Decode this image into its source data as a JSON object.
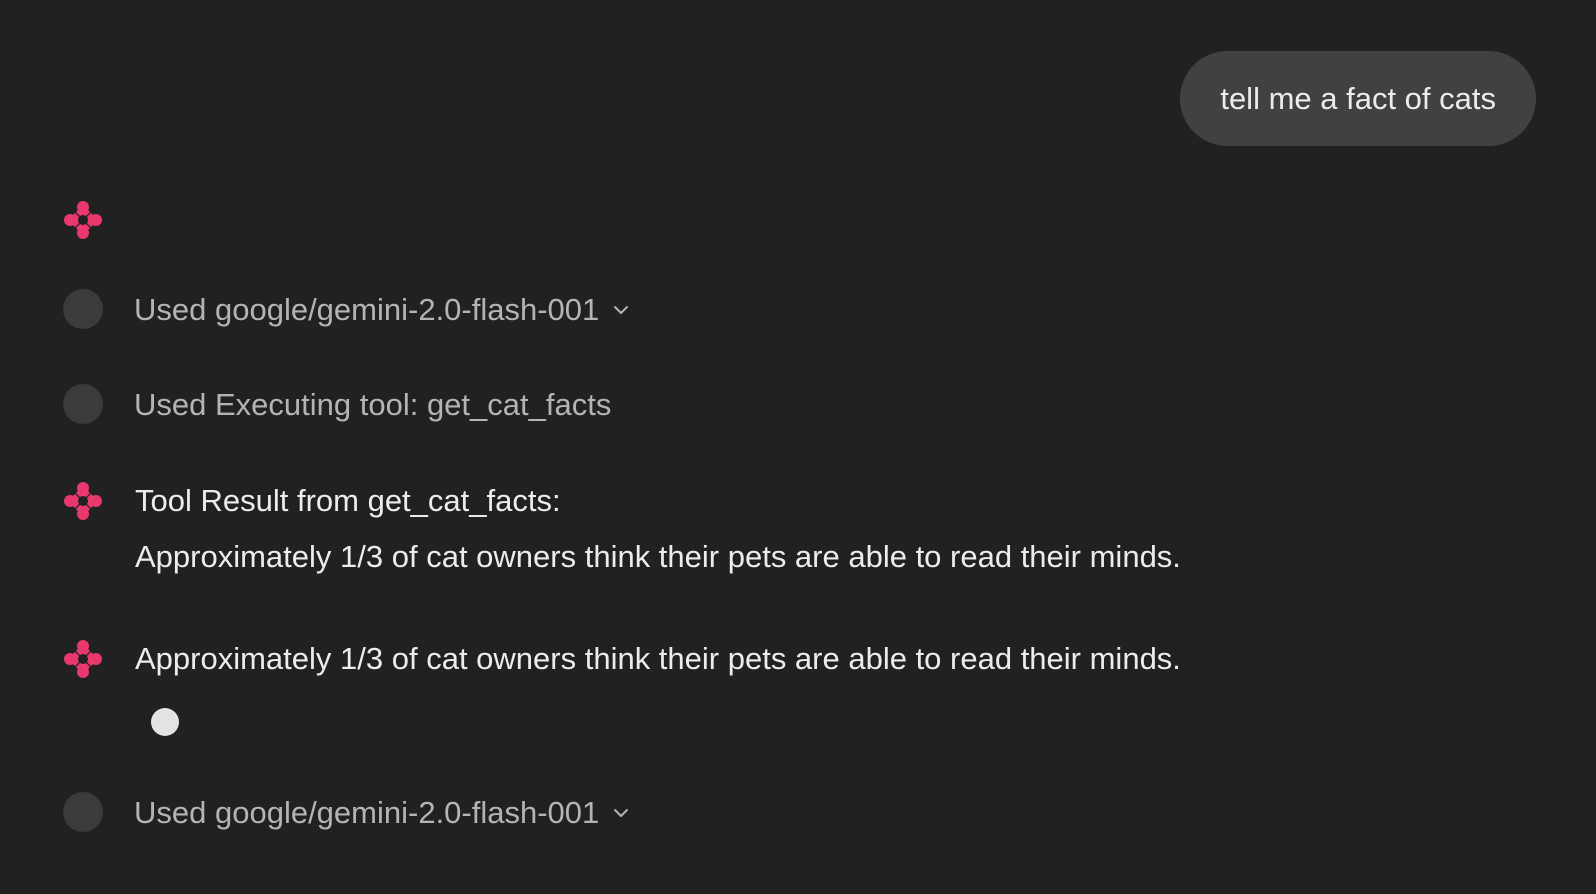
{
  "user_message": {
    "text": "tell me a fact of cats"
  },
  "steps": {
    "model_call_1": "Used google/gemini-2.0-flash-001",
    "tool_call": "Used Executing tool: get_cat_facts",
    "tool_result_title": "Tool Result from get_cat_facts:",
    "tool_result_body": "Approximately 1/3 of cat owners think their pets are able to read their minds.",
    "assistant_reply": "Approximately 1/3 of cat owners think their pets are able to read their minds.",
    "model_call_2": "Used google/gemini-2.0-flash-001"
  },
  "icons": {
    "assistant_avatar": "assistant-logo-icon",
    "expand": "chevron-down-icon",
    "step": "step-dot-icon",
    "typing": "typing-indicator-icon"
  },
  "colors": {
    "background": "#212121",
    "user_bubble": "#414141",
    "accent": "#e8386e",
    "muted_text": "#b4b4b4",
    "step_dot": "#3b3b3b"
  }
}
